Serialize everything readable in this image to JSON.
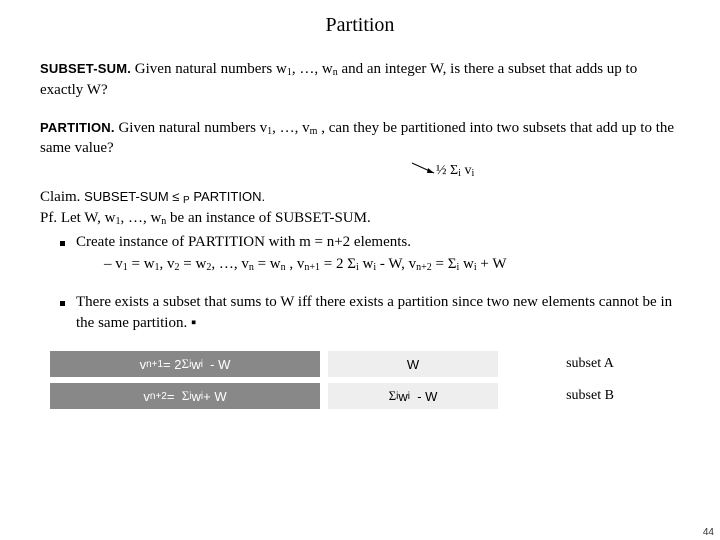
{
  "title": "Partition",
  "subsetsum": {
    "label": "SUBSET-SUM.",
    "text_a": "Given natural numbers w",
    "text_b": ", …, w",
    "text_c": " and an integer W, is there a subset that adds up to exactly W?"
  },
  "partition": {
    "label": "PARTITION.",
    "text_a": "Given natural numbers v",
    "text_b": ", …, v",
    "text_c": " , can they be partitioned into two subsets that add up to the same value?"
  },
  "half_expr": "½ Σᵢ vᵢ",
  "claim": {
    "label": "Claim.",
    "text": "SUBSET-SUM ≤ ₚ PARTITION."
  },
  "pf_label": "Pf.",
  "pf_intro_a": "Let W, w",
  "pf_intro_b": ", …, w",
  "pf_intro_c": " be an instance of SUBSET-SUM.",
  "bullet1": "Create instance of PARTITION with m = n+2 elements.",
  "dash_a": "v",
  "dash_eq": " = w",
  "dash_mid1": ",  v",
  "dash_mid2": ", …, v",
  "dash_mid3": " ,   v",
  "dash_vnp1": " = 2 Σᵢ wᵢ - W,   v",
  "dash_vnp2": " = Σᵢ wᵢ + W",
  "bullet2": "There exists a subset that sums to W iff there exists a partition since two new elements cannot be in the same partition.  ▪",
  "table": {
    "r1": {
      "left_a": "v",
      "left_b": " = 2 Σᵢ wᵢ  - W",
      "mid": "W",
      "right": "subset A"
    },
    "r2": {
      "left_a": "v",
      "left_b": " =  Σᵢ wᵢ + W",
      "mid": "Σᵢ wᵢ  - W",
      "right": "subset B"
    }
  },
  "pagenum": "44"
}
